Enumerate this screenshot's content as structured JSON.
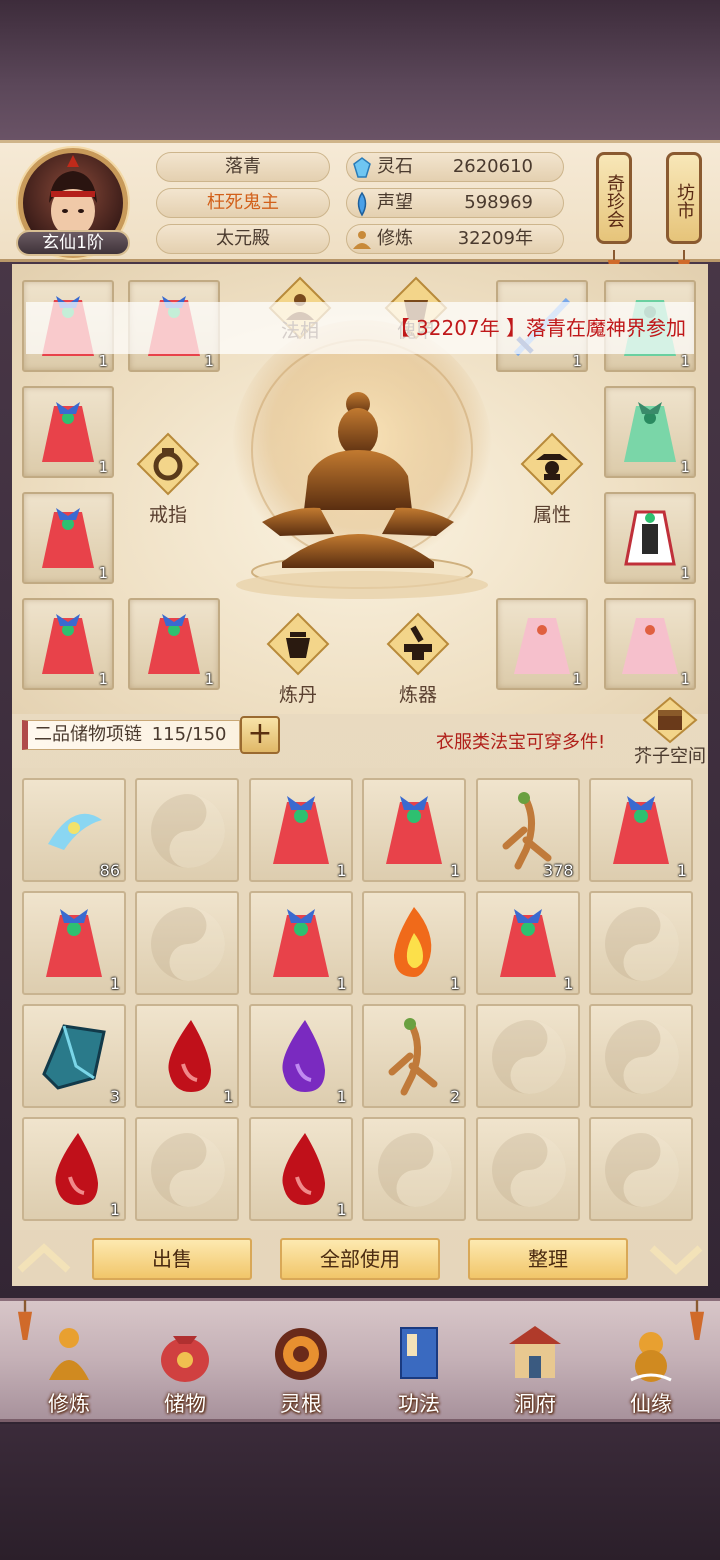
{
  "header": {
    "level": "玄仙1阶",
    "name": "落青",
    "title": "枉死鬼主",
    "sect": "太元殿",
    "stats": [
      {
        "icon": "spirit-stone-icon",
        "label": "灵石",
        "value": "2620610"
      },
      {
        "icon": "reputation-icon",
        "label": "声望",
        "value": "598969"
      },
      {
        "icon": "cultivation-icon",
        "label": "修炼",
        "value": "32209年"
      }
    ],
    "shop_buttons": [
      {
        "label": "奇珍会"
      },
      {
        "label": "坊市"
      }
    ]
  },
  "banner": {
    "prefix": "【 ",
    "year": "32207年",
    "mid": " 】",
    "text": "落青在魔神界参加"
  },
  "equip": {
    "diamonds": [
      {
        "icon": "dharma-form-icon",
        "label": "法相"
      },
      {
        "icon": "puppet-icon",
        "label": "傀甲"
      },
      {
        "icon": "ring-icon",
        "label": "戒指"
      },
      {
        "icon": "attribute-icon",
        "label": "属性"
      },
      {
        "icon": "alchemy-icon",
        "label": "炼丹"
      },
      {
        "icon": "forge-icon",
        "label": "炼器"
      }
    ],
    "slots": [
      {
        "item": "red-robe-icon",
        "count": "1"
      },
      {
        "item": "red-robe-icon",
        "count": "1"
      },
      {
        "item": "sword-icon",
        "count": "1"
      },
      {
        "item": "jade-robe-icon",
        "count": "1"
      },
      {
        "item": "red-robe-icon",
        "count": "1"
      },
      {
        "item": "jade-robe-icon",
        "count": "1"
      },
      {
        "item": "red-robe-icon",
        "count": "1"
      },
      {
        "item": "armor-robe-icon",
        "count": "1"
      },
      {
        "item": "red-robe-icon",
        "count": "1"
      },
      {
        "item": "red-robe-icon",
        "count": "1"
      },
      {
        "item": "pink-robe-icon",
        "count": "1"
      },
      {
        "item": "pink-robe-icon",
        "count": "1"
      }
    ]
  },
  "bag": {
    "name": "二品储物项链",
    "capacity": "115/150",
    "tip": "衣服类法宝可穿多件!",
    "space_label": "芥子空间",
    "cells": [
      {
        "item": "spirit-feather-icon",
        "count": "86"
      },
      {
        "item": "empty",
        "count": ""
      },
      {
        "item": "red-robe-icon",
        "count": "1"
      },
      {
        "item": "red-robe-icon",
        "count": "1"
      },
      {
        "item": "ginseng-icon",
        "count": "378"
      },
      {
        "item": "red-robe-icon",
        "count": "1"
      },
      {
        "item": "red-robe-icon",
        "count": "1"
      },
      {
        "item": "empty",
        "count": ""
      },
      {
        "item": "red-robe-icon",
        "count": "1"
      },
      {
        "item": "fire-icon",
        "count": "1"
      },
      {
        "item": "red-robe-icon",
        "count": "1"
      },
      {
        "item": "empty",
        "count": ""
      },
      {
        "item": "crystal-icon",
        "count": "3"
      },
      {
        "item": "red-flame-icon",
        "count": "1"
      },
      {
        "item": "purple-flame-icon",
        "count": "1"
      },
      {
        "item": "ginseng-icon",
        "count": "2"
      },
      {
        "item": "empty",
        "count": ""
      },
      {
        "item": "empty",
        "count": ""
      },
      {
        "item": "red-flame-icon",
        "count": "1"
      },
      {
        "item": "empty",
        "count": ""
      },
      {
        "item": "red-flame-icon",
        "count": "1"
      },
      {
        "item": "empty",
        "count": ""
      },
      {
        "item": "empty",
        "count": ""
      },
      {
        "item": "empty",
        "count": ""
      }
    ],
    "actions": {
      "sell": "出售",
      "use_all": "全部使用",
      "sort": "整理"
    }
  },
  "nav": [
    {
      "icon": "cultivate-nav-icon",
      "label": "修炼"
    },
    {
      "icon": "storage-nav-icon",
      "label": "储物"
    },
    {
      "icon": "spirit-root-nav-icon",
      "label": "灵根"
    },
    {
      "icon": "skill-book-nav-icon",
      "label": "功法"
    },
    {
      "icon": "cave-nav-icon",
      "label": "洞府"
    },
    {
      "icon": "fortune-nav-icon",
      "label": "仙缘"
    }
  ],
  "colors": {
    "accent_red": "#c0181a",
    "gold": "#f1c66a",
    "panel": "#efe2c9"
  }
}
